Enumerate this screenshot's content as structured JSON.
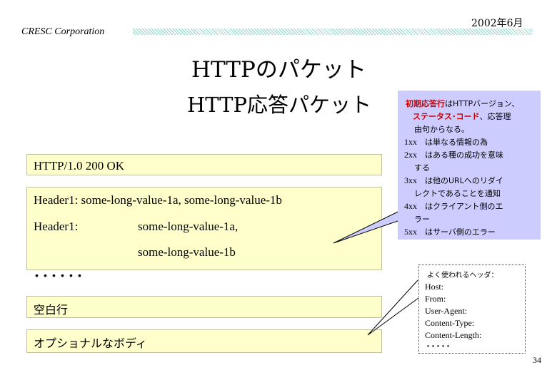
{
  "header": {
    "company": "CRESC Corporation",
    "date": "2002年6月"
  },
  "titles": {
    "main": "HTTPのパケット",
    "sub": "HTTP応答パケット"
  },
  "packet": {
    "status_line": "HTTP/1.0 200 OK",
    "header_line1": "Header1: some-long-value-1a, some-long-value-1b",
    "header2_label": "Header1:",
    "header2_value1": "some-long-value-1a,",
    "header2_value2": "some-long-value-1b",
    "ellipsis": "･･････",
    "blank_line": "空白行",
    "body": "オプショナルなボディ"
  },
  "status_callout": {
    "l1_red": "初期応答行",
    "l1_rest": "はHTTPバージョン、",
    "l2_red": "ステータス･コード",
    "l2_rest": "、応答理",
    "l3": "由句からなる。",
    "c1_code": "1xx",
    "c1_text": "は単なる情報の為",
    "c2_code": "2xx",
    "c2_text": "はある種の成功を意味",
    "c2_cont": "する",
    "c3_code": "3xx",
    "c3_text": "は他のURLへのリダイ",
    "c3_cont": "レクトであることを通知",
    "c4_code": "4xx",
    "c4_text": "はクライアント側のエ",
    "c4_cont": "ラー",
    "c5_code": "5xx",
    "c5_text": "はサーバ側のエラー"
  },
  "headers_callout": {
    "title": "よく使われるヘッダ：",
    "items": [
      "Host:",
      "From:",
      "User-Agent:",
      "Content-Type:",
      "Content-Length:"
    ],
    "ellipsis": "･････"
  },
  "page_number": "34",
  "colors": {
    "band": "#ffffcc",
    "callout": "#ccccff",
    "accent_red": "#cc0000",
    "hatch": "#8fd3c5"
  }
}
